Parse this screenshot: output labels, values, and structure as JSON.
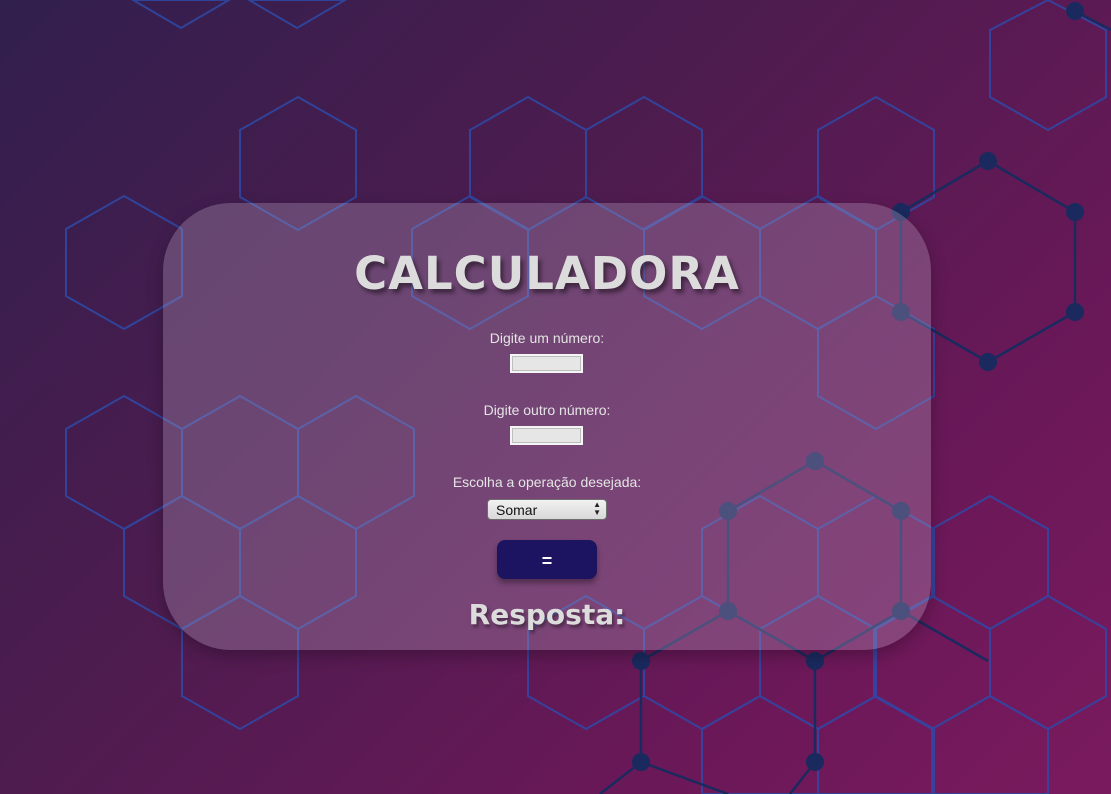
{
  "page": {
    "title": "CALCULADORA",
    "first_number_label": "Digite um número:",
    "first_number_value": "",
    "second_number_label": "Digite outro número:",
    "second_number_value": "",
    "operation_label": "Escolha a operação desejada:",
    "operation_selected": "Somar",
    "equals_label": "=",
    "answer_label": "Resposta:"
  },
  "colors": {
    "button": "#1c1460",
    "card": "rgba(190,170,200,0.30)",
    "hex_pattern": "#2e4aa8",
    "molecule": "#1a2a5e"
  },
  "icons": {
    "select_arrows": "updown-arrows-icon"
  }
}
